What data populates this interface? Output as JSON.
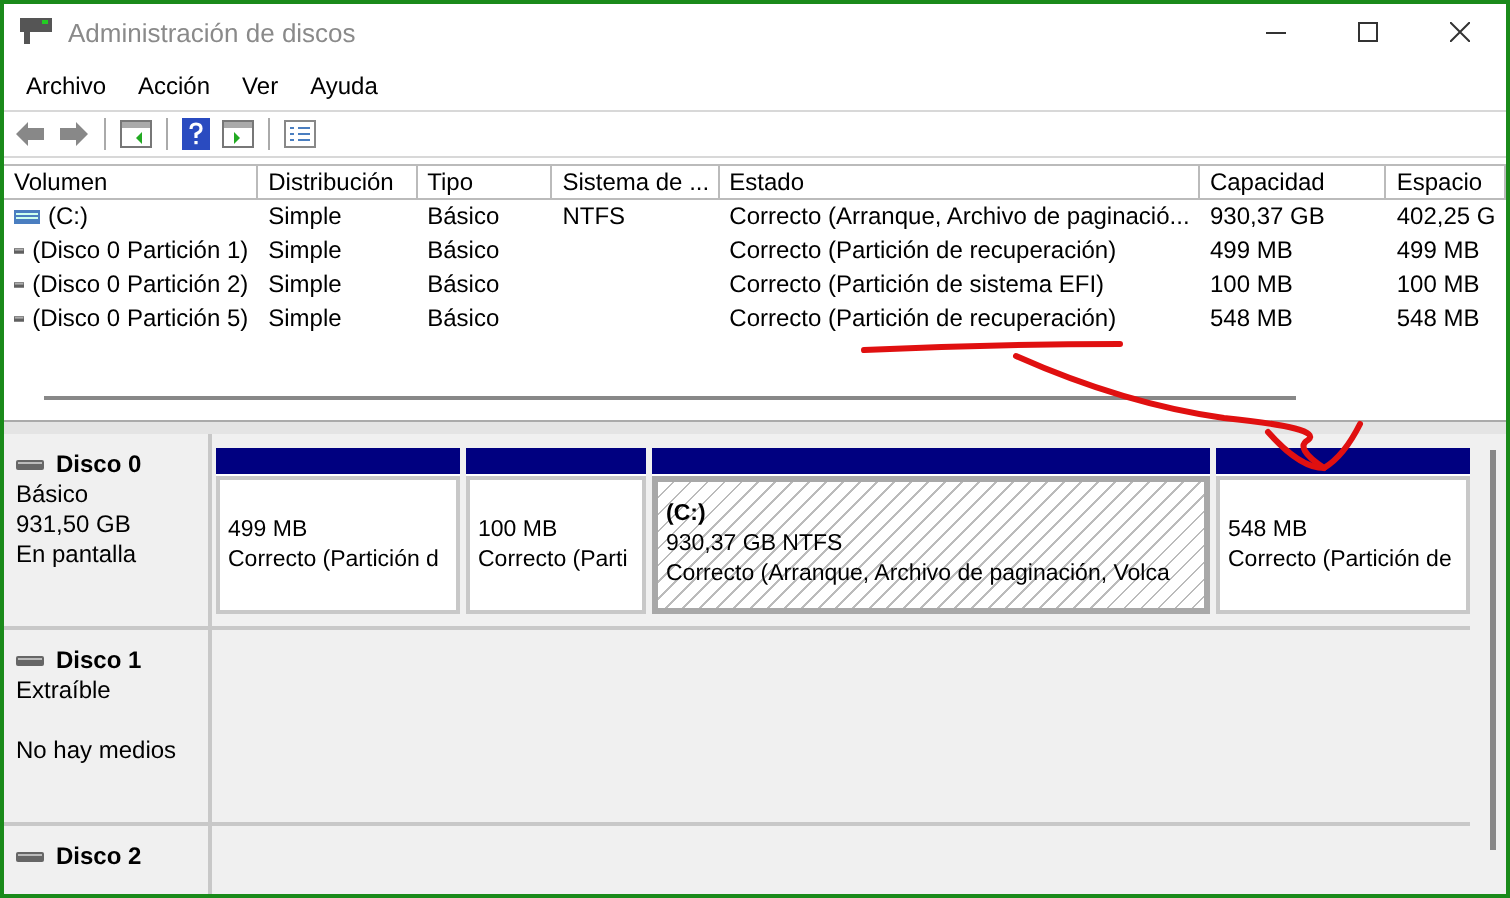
{
  "window": {
    "title": "Administración de discos"
  },
  "menu": [
    "Archivo",
    "Acción",
    "Ver",
    "Ayuda"
  ],
  "table": {
    "columns": [
      "Volumen",
      "Distribución",
      "Tipo",
      "Sistema de ...",
      "Estado",
      "Capacidad",
      "Espacio"
    ],
    "rows": [
      {
        "kind": "system",
        "cells": [
          "(C:)",
          "Simple",
          "Básico",
          "NTFS",
          "Correcto (Arranque, Archivo de paginació...",
          "930,37 GB",
          "402,25 G"
        ]
      },
      {
        "kind": "partition",
        "cells": [
          "(Disco 0 Partición 1)",
          "Simple",
          "Básico",
          "",
          "Correcto (Partición de recuperación)",
          "499 MB",
          "499 MB"
        ]
      },
      {
        "kind": "partition",
        "cells": [
          "(Disco 0 Partición 2)",
          "Simple",
          "Básico",
          "",
          "Correcto (Partición de sistema EFI)",
          "100 MB",
          "100 MB"
        ]
      },
      {
        "kind": "partition",
        "cells": [
          "(Disco 0 Partición 5)",
          "Simple",
          "Básico",
          "",
          "Correcto (Partición de recuperación)",
          "548 MB",
          "548 MB"
        ]
      }
    ]
  },
  "disks": [
    {
      "name": "Disco 0",
      "type": "Básico",
      "size": "931,50 GB",
      "status": "En pantalla",
      "partitions": [
        {
          "size": "499 MB",
          "status": "Correcto (Partición d",
          "selected": false
        },
        {
          "size": "100 MB",
          "status": "Correcto (Parti",
          "selected": false
        },
        {
          "label": "(C:)",
          "size": "930,37 GB NTFS",
          "status": "Correcto (Arranque, Archivo de paginación, Volca",
          "selected": true
        },
        {
          "size": "548 MB",
          "status": "Correcto (Partición de",
          "selected": false
        }
      ]
    },
    {
      "name": "Disco 1",
      "type": "Extraíble",
      "status": "No hay medios"
    },
    {
      "name": "Disco 2"
    }
  ]
}
